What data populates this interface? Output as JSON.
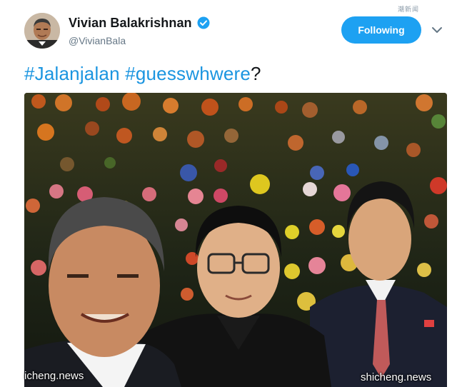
{
  "author": {
    "name": "Vivian Balakrishnan",
    "handle": "@VivianBala",
    "verified_icon": "verified-badge-icon",
    "avatar_icon": "profile-avatar"
  },
  "actions": {
    "follow_label": "Following",
    "menu_icon": "chevron-down-icon"
  },
  "tweet": {
    "hashtag1": "#Jalanjalan",
    "space": " ",
    "hashtag2": "#guesswhwere",
    "suffix": "?"
  },
  "watermarks": {
    "top": "潮新闻",
    "bottom_left": "icheng.news",
    "bottom_right": "shicheng.news"
  },
  "colors": {
    "accent": "#1da1f2",
    "hashtag": "#1b95e0",
    "text": "#14171a",
    "muted": "#657786"
  }
}
